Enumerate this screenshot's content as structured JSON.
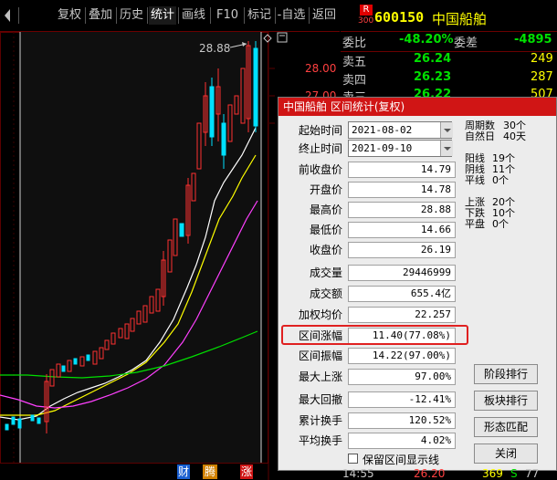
{
  "toolbar": {
    "items": [
      "复权",
      "叠加",
      "历史",
      "统计",
      "画线",
      "F10",
      "标记",
      "-自选",
      "返回"
    ],
    "active_index": 3
  },
  "chart": {
    "price_labels": [
      "28.00",
      "27.00"
    ],
    "peak_label": "28.88",
    "bottom_tags": [
      "财",
      "腾",
      "涨"
    ]
  },
  "quote": {
    "badge_top": "R",
    "badge_bottom": "300",
    "code": "600150",
    "name": "中国船舶",
    "webi_label": "委比",
    "webi_value": "-48.20%",
    "weicha_label": "委差",
    "weicha_value": "-4895",
    "asks": [
      {
        "label": "卖五",
        "price": "26.24",
        "volume": "249"
      },
      {
        "label": "卖四",
        "price": "26.23",
        "volume": "287"
      },
      {
        "label": "卖三",
        "price": "26.22",
        "volume": "507"
      }
    ],
    "time_row": {
      "time": "14:55",
      "price": "26.20",
      "volume": "369",
      "side": "S",
      "extra": "77"
    }
  },
  "dialog": {
    "title": "中国船舶 区间统计(复权)",
    "start_label": "起始时间",
    "start_value": "2021-08-02",
    "end_label": "终止时间",
    "end_value": "2021-09-10",
    "rows": [
      {
        "label": "前收盘价",
        "value": "14.79"
      },
      {
        "label": "开盘价",
        "value": "14.78"
      },
      {
        "label": "最高价",
        "value": "28.88"
      },
      {
        "label": "最低价",
        "value": "14.66"
      },
      {
        "label": "收盘价",
        "value": "26.19"
      },
      {
        "label": "成交量",
        "value": "29446999"
      },
      {
        "label": "成交额",
        "value": "655.4亿"
      },
      {
        "label": "加权均价",
        "value": "22.257"
      },
      {
        "label": "区间涨幅",
        "value": "11.40(77.08%)"
      },
      {
        "label": "区间振幅",
        "value": "14.22(97.00%)"
      },
      {
        "label": "最大上涨",
        "value": "97.00%"
      },
      {
        "label": "最大回撤",
        "value": "-12.41%"
      },
      {
        "label": "累计换手",
        "value": "120.52%"
      },
      {
        "label": "平均换手",
        "value": "4.02%"
      }
    ],
    "stats": [
      {
        "label": "周期数",
        "value": "30个"
      },
      {
        "label": "自然日",
        "value": "40天"
      },
      {
        "label": "阳线",
        "value": "19个"
      },
      {
        "label": "阴线",
        "value": "11个"
      },
      {
        "label": "平线",
        "value": "0个"
      },
      {
        "label": "上涨",
        "value": "20个"
      },
      {
        "label": "下跌",
        "value": "10个"
      },
      {
        "label": "平盘",
        "value": "0个"
      }
    ],
    "buttons": [
      "阶段排行",
      "板块排行",
      "形态匹配",
      "关闭"
    ],
    "checkbox_label": "保留区间显示线"
  },
  "colors": {
    "title_bar": "#d01515",
    "up": "#ff3030",
    "down": "#00e0ff",
    "highlight": "#e02020"
  }
}
